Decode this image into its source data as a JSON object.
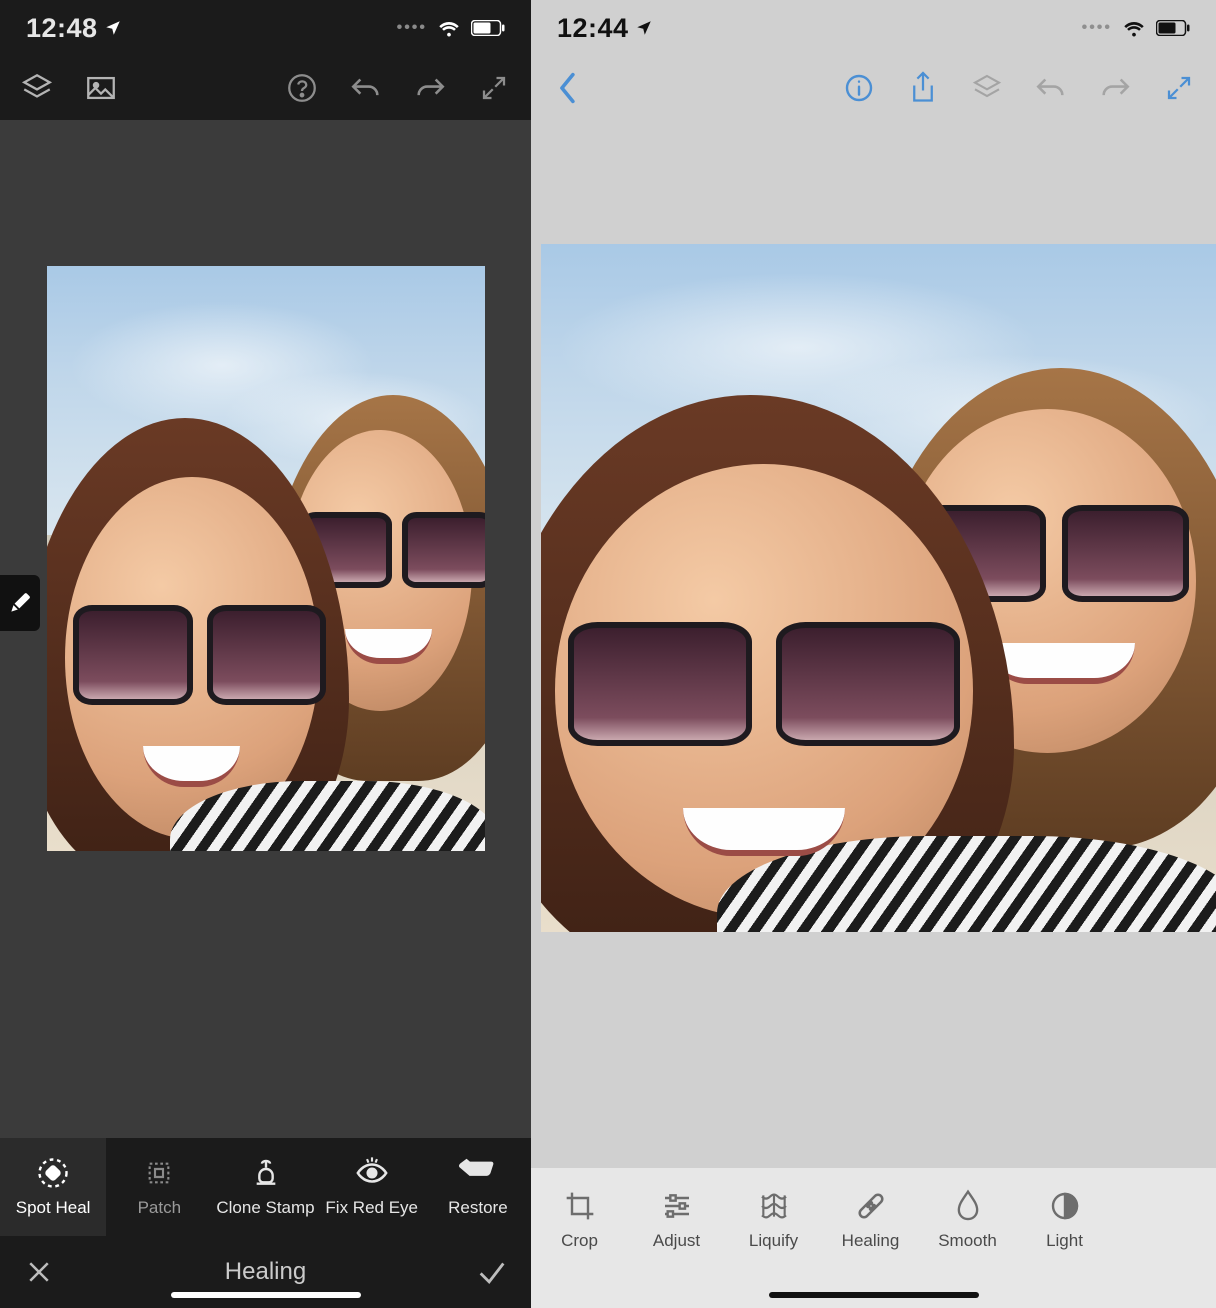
{
  "left": {
    "status": {
      "time": "12:48"
    },
    "healing_tools": [
      {
        "label": "Spot Heal",
        "active": true
      },
      {
        "label": "Patch",
        "active": false
      },
      {
        "label": "Clone Stamp",
        "active": false
      },
      {
        "label": "Fix Red Eye",
        "active": false
      },
      {
        "label": "Restore",
        "active": false
      }
    ],
    "mode_title": "Healing"
  },
  "right": {
    "status": {
      "time": "12:44"
    },
    "tools": [
      {
        "label": "Crop"
      },
      {
        "label": "Adjust"
      },
      {
        "label": "Liquify"
      },
      {
        "label": "Healing"
      },
      {
        "label": "Smooth"
      },
      {
        "label": "Light"
      }
    ]
  }
}
